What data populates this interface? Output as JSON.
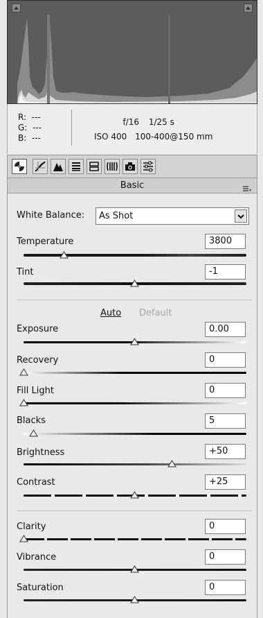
{
  "histogram": {
    "label": "histogram"
  },
  "readout": {
    "r": "R:  ---",
    "g": "G:  ---",
    "b": "B:  ---",
    "aperture": "f/16",
    "shutter": "1/25 s",
    "iso": "ISO 400",
    "lens": "100-400@150 mm"
  },
  "toolbar": {
    "tools": [
      "basic-icon",
      "tone-curve-icon",
      "detail-icon",
      "hsl-icon",
      "split-toning-icon",
      "lens-corrections-icon",
      "camera-calibration-icon",
      "presets-icon"
    ],
    "active": "basic-icon"
  },
  "panel": {
    "title": "Basic",
    "white_balance_label": "White Balance:",
    "white_balance_value": "As Shot",
    "auto": "Auto",
    "default": "Default"
  },
  "sliders": {
    "temperature": {
      "label": "Temperature",
      "value": "3800"
    },
    "tint": {
      "label": "Tint",
      "value": "-1"
    },
    "exposure": {
      "label": "Exposure",
      "value": "0.00"
    },
    "recovery": {
      "label": "Recovery",
      "value": "0"
    },
    "fill_light": {
      "label": "Fill Light",
      "value": "0"
    },
    "blacks": {
      "label": "Blacks",
      "value": "5"
    },
    "brightness": {
      "label": "Brightness",
      "value": "+50"
    },
    "contrast": {
      "label": "Contrast",
      "value": "+25"
    },
    "clarity": {
      "label": "Clarity",
      "value": "0"
    },
    "vibrance": {
      "label": "Vibrance",
      "value": "0"
    },
    "saturation": {
      "label": "Saturation",
      "value": "0"
    }
  },
  "colors": {
    "panel_bg": "#e9e9e9",
    "histogram_bg": "#5c5c5c",
    "text": "#111111",
    "disabled_text": "#a9a9a9"
  }
}
